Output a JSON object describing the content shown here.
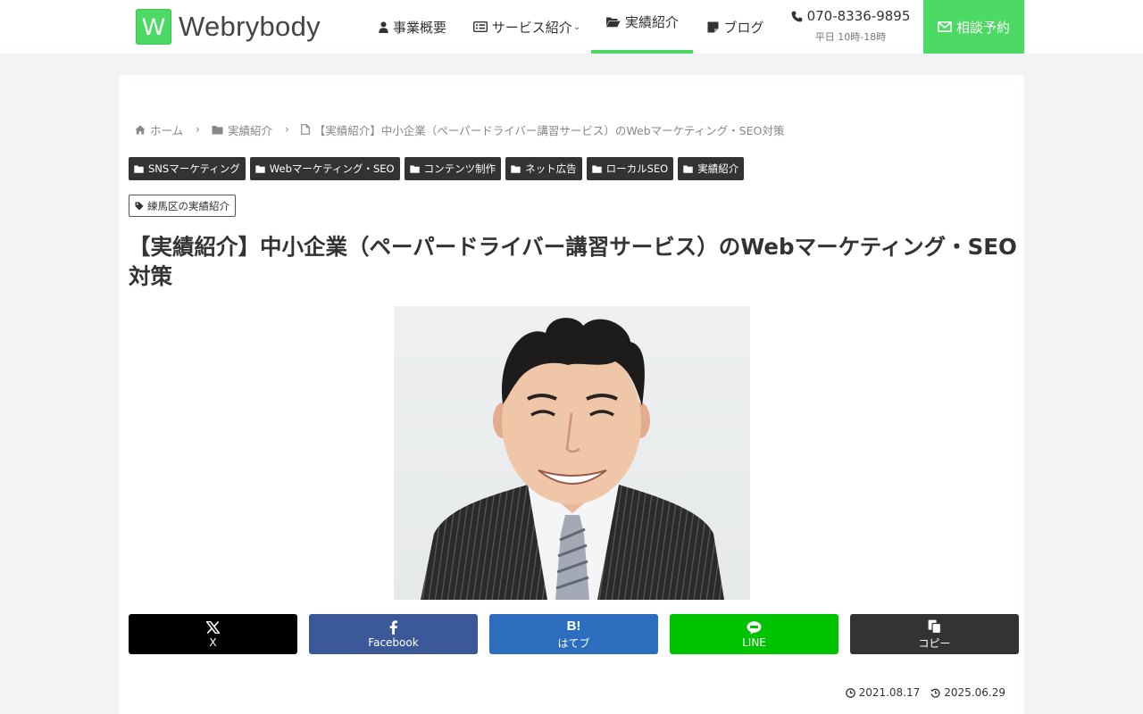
{
  "header": {
    "logo_letter": "W",
    "logo_text": "Webrybody",
    "nav": [
      {
        "label": "事業概要",
        "icon": "user-icon"
      },
      {
        "label": "サービス紹介",
        "icon": "list-icon",
        "has_dropdown": true
      },
      {
        "label": "実績紹介",
        "icon": "folder-open-icon",
        "active": true
      },
      {
        "label": "ブログ",
        "icon": "sticky-note-icon"
      }
    ],
    "tel": {
      "number": "070-8336-9895",
      "hours": "平日 10時-18時"
    },
    "cta_label": "相談予約",
    "accent": "#4cd964"
  },
  "breadcrumb": [
    {
      "label": "ホーム",
      "icon": "home-icon"
    },
    {
      "label": "実績紹介",
      "icon": "folder-icon"
    },
    {
      "label": "【実績紹介】中小企業（ペーパードライバー講習サービス）のWebマーケティング・SEO対策",
      "icon": "file-icon"
    }
  ],
  "categories": [
    "SNSマーケティング",
    "Webマーケティング・SEO",
    "コンテンツ制作",
    "ネット広告",
    "ローカルSEO",
    "実績紹介"
  ],
  "tag": "練馬区の実績紹介",
  "title": "【実績紹介】中小企業（ペーパードライバー講習サービス）のWebマーケティング・SEO対策",
  "share": [
    {
      "label": "X",
      "color": "#000000"
    },
    {
      "label": "Facebook",
      "color": "#3b5998"
    },
    {
      "label": "はてブ",
      "mark": "B!",
      "color": "#2c6ebd"
    },
    {
      "label": "LINE",
      "color": "#00c300"
    },
    {
      "label": "コピー",
      "color": "#333333"
    }
  ],
  "dates": {
    "posted": "2021.08.17",
    "updated": "2025.06.29"
  }
}
